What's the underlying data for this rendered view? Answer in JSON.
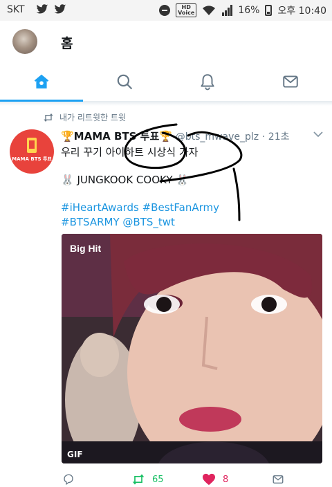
{
  "status_bar": {
    "carrier": "SKT",
    "hd_voice": "HD Voice",
    "battery": "16%",
    "time": "오후 10:40"
  },
  "header": {
    "title": "홈"
  },
  "tabs": [
    {
      "name": "home",
      "active": true
    },
    {
      "name": "search",
      "active": false
    },
    {
      "name": "notifications",
      "active": false
    },
    {
      "name": "messages",
      "active": false
    }
  ],
  "tweet": {
    "retweet_label": "내가 리트윗한 트윗",
    "avatar_text": "MAMA BTS 투표",
    "display_name": "🏆MAMA BTS 투표🏆",
    "handle": "@bts_mwave_plz",
    "time": "· 21초",
    "line1": "우리 꾸기 아이하트 시상식 가자",
    "line2": "🐰 JUNGKOOK COOKY 🐰",
    "hashtags1": "#iHeartAwards #BestFanArmy",
    "hashtags2": "#BTSARMY @BTS_twt",
    "media_badge": "GIF",
    "retweets": "65",
    "likes": "8"
  },
  "colors": {
    "accent": "#1da1f2",
    "retweet_green": "#17bf63",
    "like_red": "#e0245e",
    "muted": "#657786",
    "avatar_red": "#e8433c"
  }
}
